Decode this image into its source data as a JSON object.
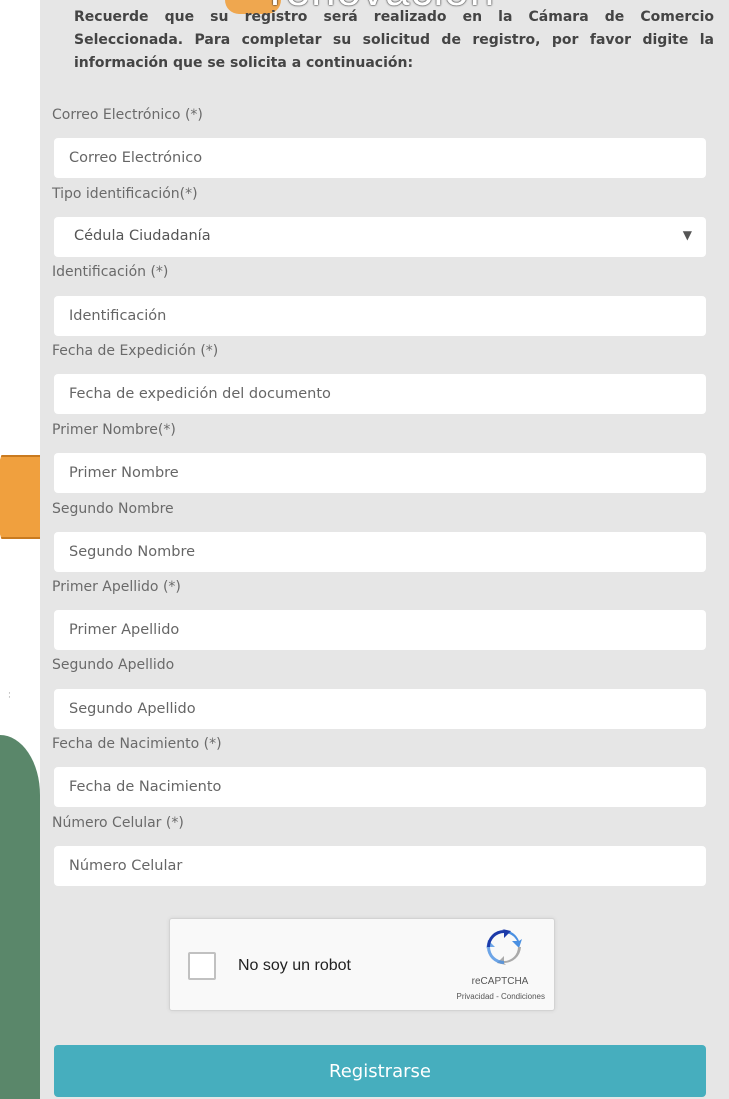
{
  "header": {
    "overlay_title": "renovación",
    "intro": "Recuerde que su registro será realizado en la Cámara de Comercio Seleccionada. Para completar su solicitud de registro, por favor digite la información que se solicita a continuación:"
  },
  "form": {
    "email": {
      "label": "Correo Electrónico (*)",
      "placeholder": "Correo Electrónico"
    },
    "id_type": {
      "label": "Tipo identificación(*)",
      "value": "Cédula Ciudadanía"
    },
    "id_number": {
      "label": "Identificación (*)",
      "placeholder": "Identificación"
    },
    "issue_date": {
      "label": "Fecha de Expedición (*)",
      "placeholder": "Fecha de expedición del documento"
    },
    "first_name": {
      "label": "Primer Nombre(*)",
      "placeholder": "Primer Nombre"
    },
    "second_name": {
      "label": "Segundo Nombre",
      "placeholder": "Segundo Nombre"
    },
    "first_surname": {
      "label": "Primer Apellido (*)",
      "placeholder": "Primer Apellido"
    },
    "second_surname": {
      "label": "Segundo Apellido",
      "placeholder": "Segundo Apellido"
    },
    "birth_date": {
      "label": "Fecha de Nacimiento (*)",
      "placeholder": "Fecha de Nacimiento"
    },
    "mobile": {
      "label": "Número Celular (*)",
      "placeholder": "Número Celular"
    }
  },
  "captcha": {
    "label": "No soy un robot",
    "brand": "reCAPTCHA",
    "terms": "Privacidad - Condiciones",
    "checked": false
  },
  "submit_label": "Registrarse",
  "colors": {
    "panel_bg": "#e6e6e6",
    "submit_bg": "#46aebe",
    "accent_orange": "#f0a03e",
    "side_green": "#5a876a"
  }
}
